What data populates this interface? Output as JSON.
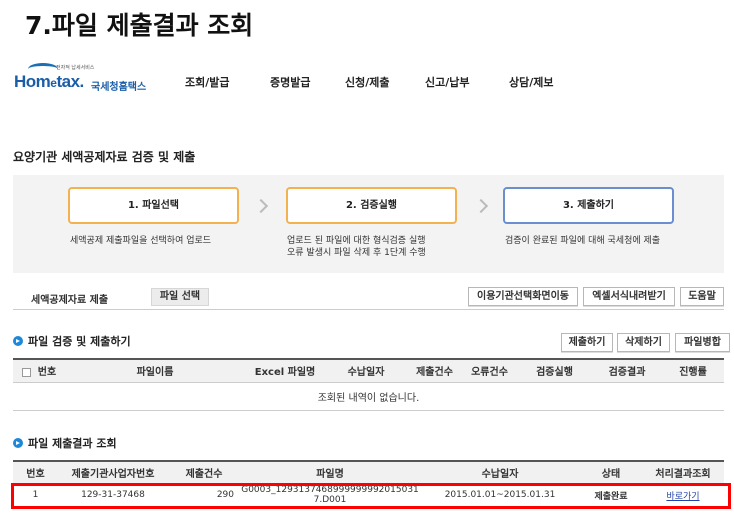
{
  "page_title": "7.파일 제출결과 조회",
  "header": {
    "logo_sub": "전자적 납세서비스",
    "logo_main_a": "Hom",
    "logo_main_e": "e",
    "logo_main_b": "tax.",
    "logo_kr": "국세청홈택스",
    "menu": [
      "조회/발급",
      "증명발급",
      "신청/제출",
      "신고/납부",
      "상담/제보"
    ]
  },
  "section_title": "요양기관 세액공제자료 검증 및 제출",
  "steps": [
    {
      "label": "1. 파일선택",
      "desc": [
        "세액공제 제출파일을 선택하여 업로드"
      ]
    },
    {
      "label": "2. 검증실행",
      "desc": [
        "업로드 된 파일에 대한 형식검증 실행",
        "오류 발생시 파일 삭제 후 1단계 수행"
      ]
    },
    {
      "label": "3. 제출하기",
      "desc": [
        "검증이 완료된 파일에 대해 국세청에 제출"
      ]
    }
  ],
  "tabbar": {
    "label": "세액공제자료 제출",
    "file_select": "파일 선택",
    "buttons": [
      "이용기관선택화면이동",
      "엑셀서식내려받기",
      "도움말"
    ]
  },
  "verify": {
    "title": "파일 검증 및 제출하기",
    "buttons": [
      "제출하기",
      "삭제하기",
      "파일병합"
    ],
    "columns": [
      "번호",
      "파일이름",
      "Excel 파일명",
      "수납일자",
      "제출건수",
      "오류건수",
      "검증실행",
      "검증결과",
      "진행률"
    ],
    "empty_message": "조회된 내역이 없습니다."
  },
  "results": {
    "title": "파일 제출결과 조회",
    "columns": [
      "번호",
      "제출기관사업자번호",
      "제출건수",
      "파일명",
      "수납일자",
      "상태",
      "처리결과조회"
    ],
    "rows": [
      {
        "no": "1",
        "biz_no": "129-31-37468",
        "count": "290",
        "file": "G0003_1293137468999999992015031 7.D001",
        "date": "2015.01.01~2015.01.31",
        "status": "제출완료",
        "action": "바로가기"
      }
    ]
  }
}
